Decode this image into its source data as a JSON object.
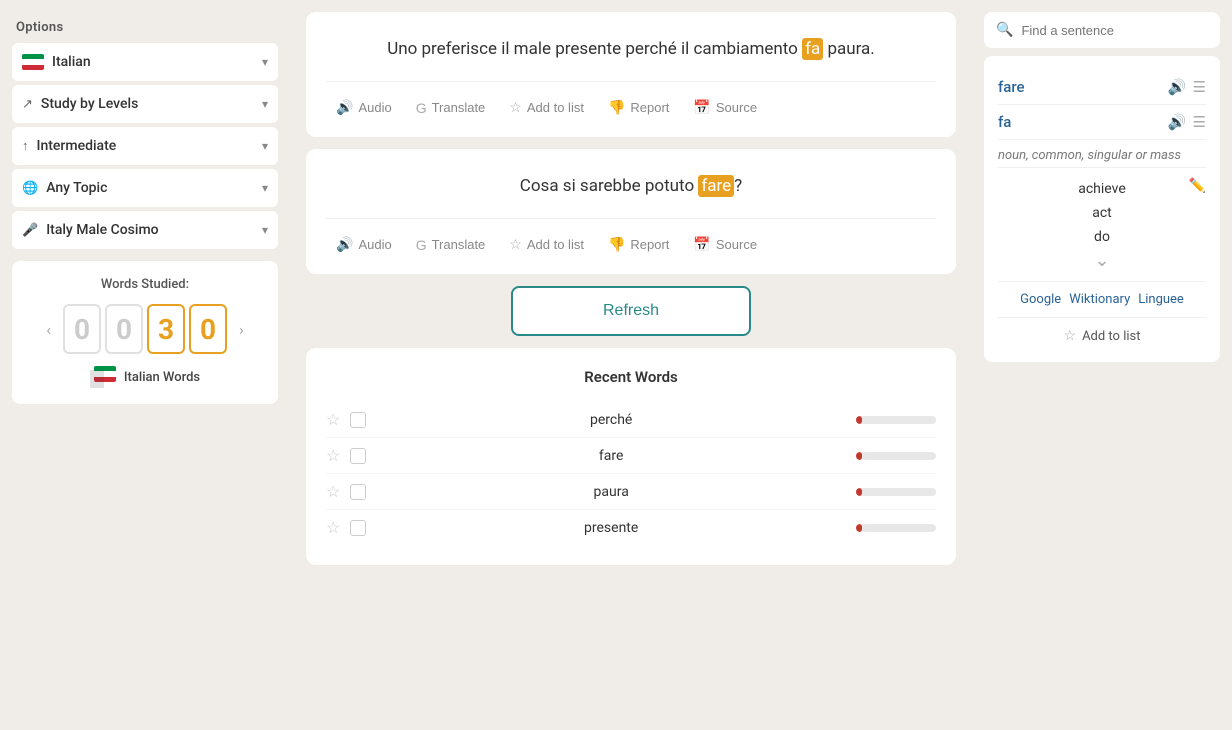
{
  "sidebar": {
    "title": "Options",
    "items": [
      {
        "id": "language",
        "label": "Italian",
        "icon": "flag-it",
        "hasChevron": true
      },
      {
        "id": "study-levels",
        "label": "Study by Levels",
        "icon": "trend",
        "hasChevron": true
      },
      {
        "id": "intermediate",
        "label": "Intermediate",
        "icon": "levels",
        "hasChevron": true
      },
      {
        "id": "any-topic",
        "label": "Any Topic",
        "icon": "globe",
        "hasChevron": true
      },
      {
        "id": "italy-male",
        "label": "Italy Male Cosimo",
        "icon": "mic",
        "hasChevron": true
      }
    ]
  },
  "words_studied": {
    "label": "Words Studied:",
    "digits": [
      "0",
      "0",
      "3",
      "0"
    ],
    "footer_label": "Italian Words"
  },
  "sentences": [
    {
      "id": "s1",
      "text_parts": [
        "Uno preferisce il male presente perché il cambiamento ",
        "fa",
        " paura."
      ],
      "highlight_index": 1,
      "actions": [
        "Audio",
        "Translate",
        "Add to list",
        "Report",
        "Source"
      ]
    },
    {
      "id": "s2",
      "text_parts": [
        "Cosa si sarebbe potuto ",
        "fare",
        "?"
      ],
      "highlight_index": 1,
      "actions": [
        "Audio",
        "Translate",
        "Add to list",
        "Report",
        "Source"
      ]
    }
  ],
  "refresh_button": "Refresh",
  "recent_words": {
    "title": "Recent Words",
    "words": [
      {
        "name": "perché",
        "progress": 8
      },
      {
        "name": "fare",
        "progress": 8
      },
      {
        "name": "paura",
        "progress": 8
      },
      {
        "name": "presente",
        "progress": 8
      }
    ]
  },
  "right_panel": {
    "search_placeholder": "Find a sentence",
    "primary_word": "fare",
    "secondary_word": "fa",
    "pos": "noun, common, singular or mass",
    "translations": [
      "achieve",
      "act",
      "do"
    ],
    "external_links": [
      "Google",
      "Wiktionary",
      "Linguee"
    ],
    "add_to_list_label": "Add to list"
  }
}
